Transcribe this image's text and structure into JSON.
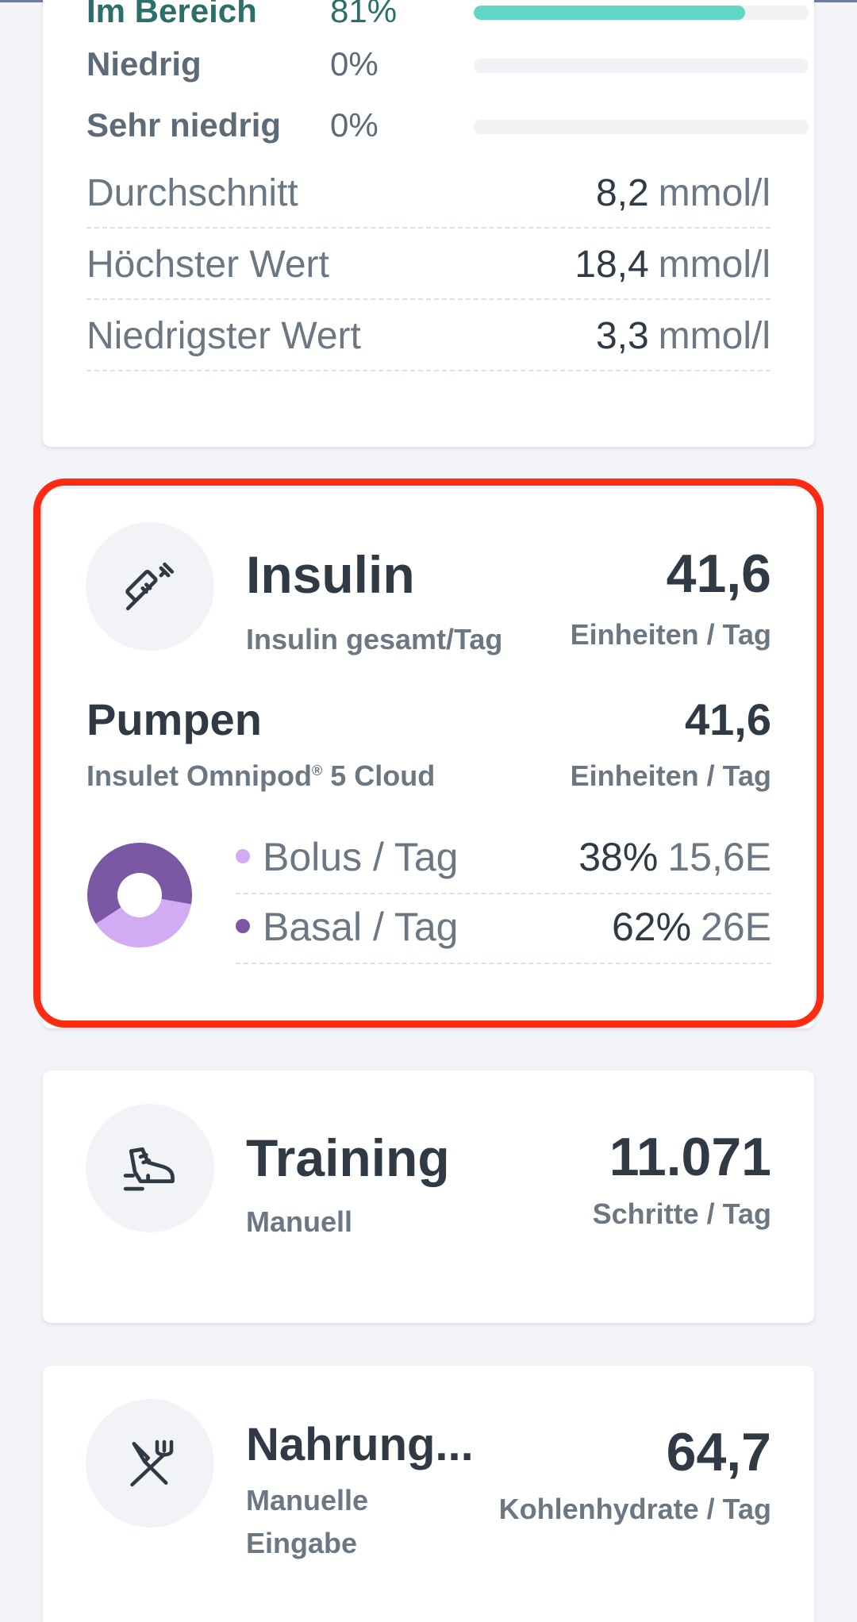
{
  "colors": {
    "background": "#f3f4f8",
    "card": "#ffffff",
    "highlight": "#ff2a12",
    "in_range_bar": "#5fd7c3",
    "bolus": "#d3abf4",
    "basal": "#7a58a3"
  },
  "glucose_card": {
    "ranges": [
      {
        "label": "Im Bereich",
        "value": "81%",
        "fraction": 0.81
      },
      {
        "label": "Niedrig",
        "value": "0%",
        "fraction": 0
      },
      {
        "label": "Sehr niedrig",
        "value": "0%",
        "fraction": 0
      }
    ],
    "stats": [
      {
        "label": "Durchschnitt",
        "value": "8,2",
        "unit": "mmol/l"
      },
      {
        "label": "Höchster Wert",
        "value": "18,4",
        "unit": "mmol/l"
      },
      {
        "label": "Niedrigster Wert",
        "value": "3,3",
        "unit": "mmol/l"
      }
    ]
  },
  "insulin_card": {
    "icon": "syringe-icon",
    "title": "Insulin",
    "subtitle": "Insulin gesamt/Tag",
    "value": "41,6",
    "unit": "Einheiten / Tag",
    "pump": {
      "title": "Pumpen",
      "device_name": "Insulet Omnipod",
      "device_mark": "®",
      "device_suffix": "5 Cloud",
      "value": "41,6",
      "unit": "Einheiten / Tag"
    },
    "split": [
      {
        "label": "Bolus / Tag",
        "percent": "38%",
        "amount": "15,6E",
        "fraction": 0.38
      },
      {
        "label": "Basal / Tag",
        "percent": "62%",
        "amount": "26E",
        "fraction": 0.62
      }
    ]
  },
  "training_card": {
    "icon": "sneaker-icon",
    "title": "Training",
    "subtitle": "Manuell",
    "value": "11.071",
    "unit": "Schritte / Tag"
  },
  "food_card": {
    "icon": "fork-knife-icon",
    "title": "Nahrung...",
    "subtitle_line1": "Manuelle",
    "subtitle_line2": "Eingabe",
    "value": "64,7",
    "unit": "Kohlenhydrate / Tag"
  }
}
